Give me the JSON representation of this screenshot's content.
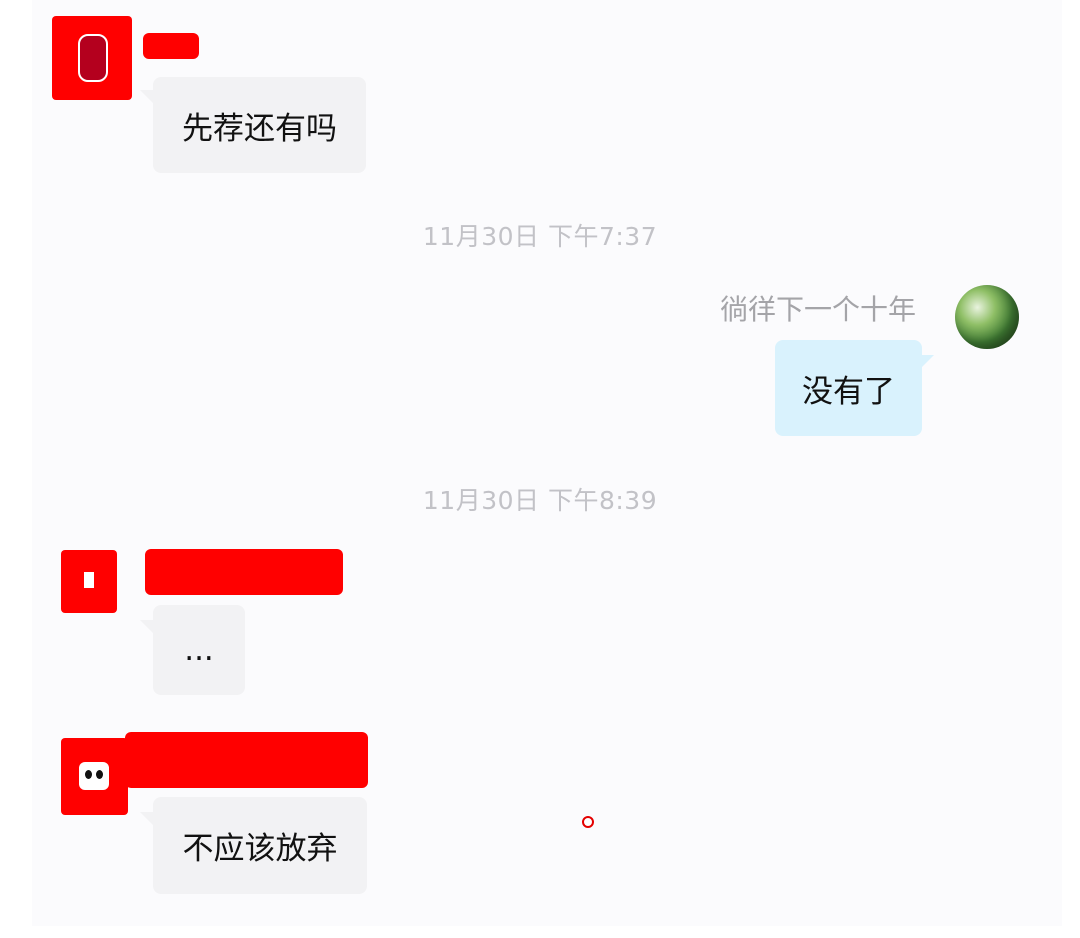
{
  "messages": [
    {
      "side": "incoming",
      "text": "先荐还有吗"
    },
    {
      "side": "outgoing",
      "sender": "徜徉下一个十年",
      "text": "没有了"
    },
    {
      "side": "incoming",
      "text": "..."
    },
    {
      "side": "incoming",
      "text": "不应该放弃"
    }
  ],
  "timestamps": [
    "11月30日  下午7:37",
    "11月30日  下午8:39"
  ],
  "colors": {
    "incoming_bubble": "#f2f2f4",
    "outgoing_bubble": "#d9f2fd",
    "redaction": "#ff0000",
    "timestamp_text": "#c2c2c7"
  },
  "icons": {
    "user_avatar": "globe-avatar-icon",
    "cursor": "mouse-cursor-circle-icon"
  }
}
